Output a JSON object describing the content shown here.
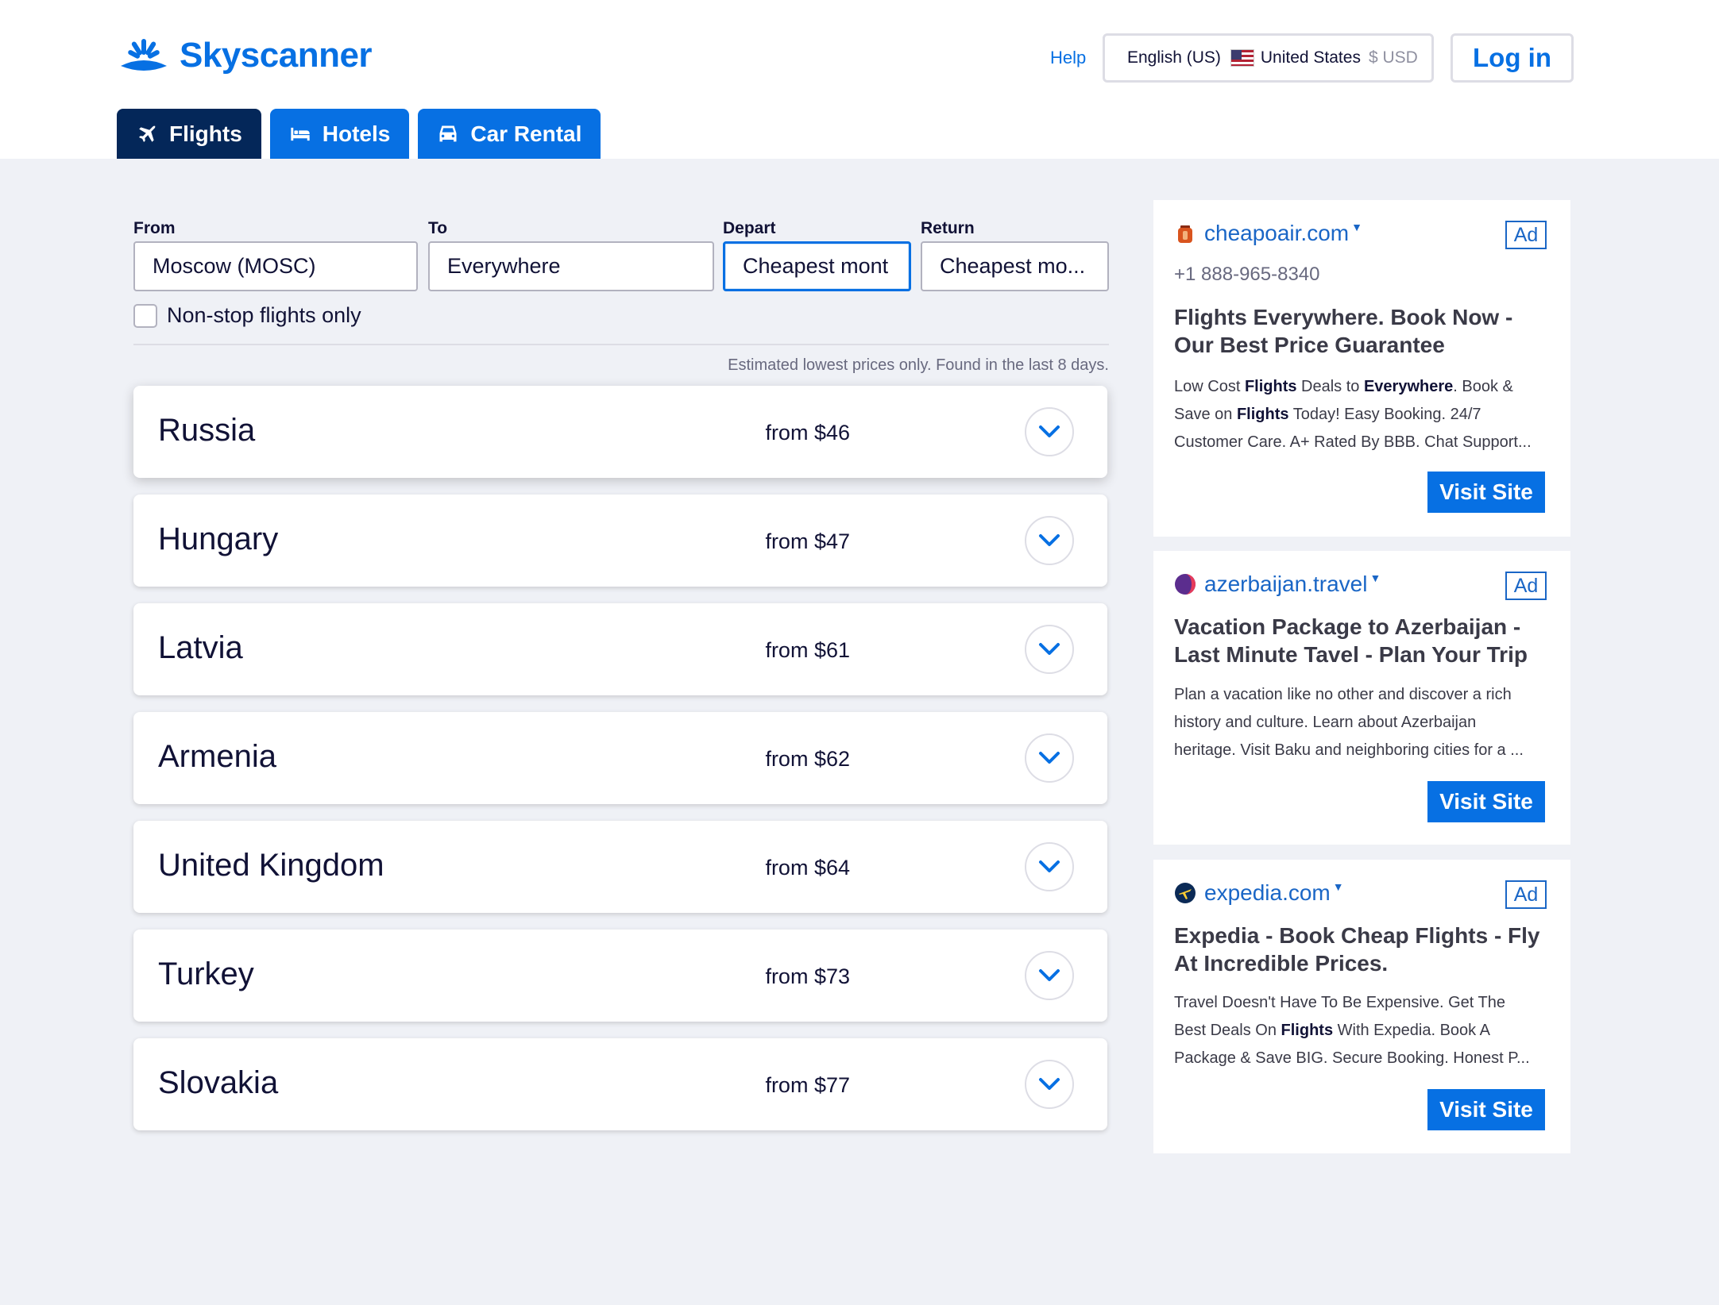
{
  "brand": {
    "name": "Skyscanner",
    "color": "#0770e3"
  },
  "header": {
    "help": "Help",
    "locale": {
      "language": "English (US)",
      "country": "United States",
      "currency": "$ USD"
    },
    "login": "Log in"
  },
  "tabs": [
    {
      "label": "Flights",
      "icon": "plane-icon",
      "active": true
    },
    {
      "label": "Hotels",
      "icon": "bed-icon",
      "active": false
    },
    {
      "label": "Car Rental",
      "icon": "car-icon",
      "active": false
    }
  ],
  "search": {
    "from": {
      "label": "From",
      "value": "Moscow (MOSC)"
    },
    "to": {
      "label": "To",
      "value": "Everywhere"
    },
    "depart": {
      "label": "Depart",
      "value": "Cheapest mont"
    },
    "return": {
      "label": "Return",
      "value": "Cheapest mo..."
    },
    "nonstop": {
      "label": "Non-stop flights only",
      "checked": false
    },
    "note": "Estimated lowest prices only. Found in the last 8 days."
  },
  "results": [
    {
      "country": "Russia",
      "price": "from $46"
    },
    {
      "country": "Hungary",
      "price": "from $47"
    },
    {
      "country": "Latvia",
      "price": "from $61"
    },
    {
      "country": "Armenia",
      "price": "from $62"
    },
    {
      "country": "United Kingdom",
      "price": "from $64"
    },
    {
      "country": "Turkey",
      "price": "from $73"
    },
    {
      "country": "Slovakia",
      "price": "from $77"
    }
  ],
  "ads": [
    {
      "brand": "cheapoair.com",
      "icon": "cheapoair-icon",
      "badge": "Ad",
      "phone": "+1 888-965-8340",
      "headline_1": "Flights Everywhere. Book Now -",
      "headline_2": "Our Best Price Guarantee",
      "desc_html": "Low Cost <b>Flights</b> Deals to <b>Everywhere</b>. Book &amp;<br>Save on <b>Flights</b> Today! Easy Booking. 24/7<br>Customer Care. A+ Rated By BBB. Chat Support...",
      "cta": "Visit Site"
    },
    {
      "brand": "azerbaijan.travel",
      "icon": "azerbaijan-icon",
      "badge": "Ad",
      "headline_1": "Vacation Package to Azerbaijan -",
      "headline_2": "Last Minute Tavel - Plan Your Trip",
      "desc_html": "Plan a vacation like no other and discover a rich<br>history and culture. Learn about Azerbaijan<br>heritage. Visit Baku and neighboring cities for a ...",
      "cta": "Visit Site"
    },
    {
      "brand": "expedia.com",
      "icon": "expedia-icon",
      "badge": "Ad",
      "headline_1": "Expedia - Book Cheap Flights - Fly",
      "headline_2": "At Incredible Prices.",
      "desc_html": "Travel Doesn't Have To Be Expensive. Get The<br>Best Deals On <b>Flights</b> With Expedia. Book A<br>Package &amp; Save BIG. Secure Booking. Honest P...",
      "cta": "Visit Site"
    }
  ]
}
